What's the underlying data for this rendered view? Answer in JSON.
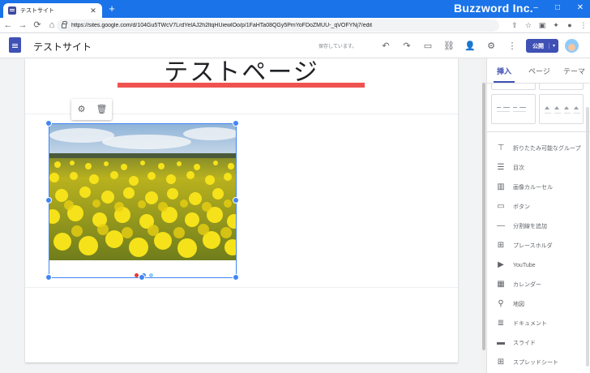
{
  "browser": {
    "tab_title": "テストサイト",
    "tab_close": "✕",
    "new_tab": "+",
    "brand": "Buzzword Inc.",
    "url": "https://sites.google.com/d/104Gu5TWcV7LrdYeIAJ2h2ltqHUiewlOo/p/1FaHTa08QGy5PmYoFDoZMUU-_qVOFYNj7/edit",
    "controls": {
      "minimize": "–",
      "maximize": "□",
      "close": "✕"
    },
    "nav": {
      "back": "←",
      "forward": "→",
      "reload": "⟳",
      "home": "⌂"
    }
  },
  "header": {
    "site_name": "テストサイト",
    "status": "保存しています。",
    "publish_label": "公開",
    "publish_caret": "▾",
    "icons": {
      "undo": "↶",
      "redo": "↷",
      "preview": "▭",
      "link": "⛓",
      "share": "👤",
      "settings": "⚙",
      "more": "⋮"
    }
  },
  "page": {
    "title": "テストページ",
    "image_toolbar": {
      "settings": "⚙",
      "delete": "🗑"
    }
  },
  "panel": {
    "tabs": [
      {
        "label": "挿入",
        "active": true
      },
      {
        "label": "ページ",
        "active": false
      },
      {
        "label": "テーマ",
        "active": false
      }
    ],
    "items": [
      {
        "label": "折りたたみ可能なグループ",
        "icon": "⊤"
      },
      {
        "label": "目次",
        "icon": "☰"
      },
      {
        "label": "画像カルーセル",
        "icon": "▥"
      },
      {
        "label": "ボタン",
        "icon": "▭"
      },
      {
        "label": "分割線を追加",
        "icon": "—"
      },
      {
        "label": "プレースホルダ",
        "icon": "⊞"
      },
      {
        "label": "YouTube",
        "icon": "▶"
      },
      {
        "label": "カレンダー",
        "icon": "▦"
      },
      {
        "label": "地図",
        "icon": "⚲"
      },
      {
        "label": "ドキュメント",
        "icon": "≣"
      },
      {
        "label": "スライド",
        "icon": "▬"
      },
      {
        "label": "スプレッドシート",
        "icon": "⊞"
      }
    ]
  },
  "colors": {
    "brand_blue": "#1a73e8",
    "sites_indigo": "#3f51b5",
    "title_underline": "#ef5350",
    "selection_blue": "#4285f4"
  }
}
